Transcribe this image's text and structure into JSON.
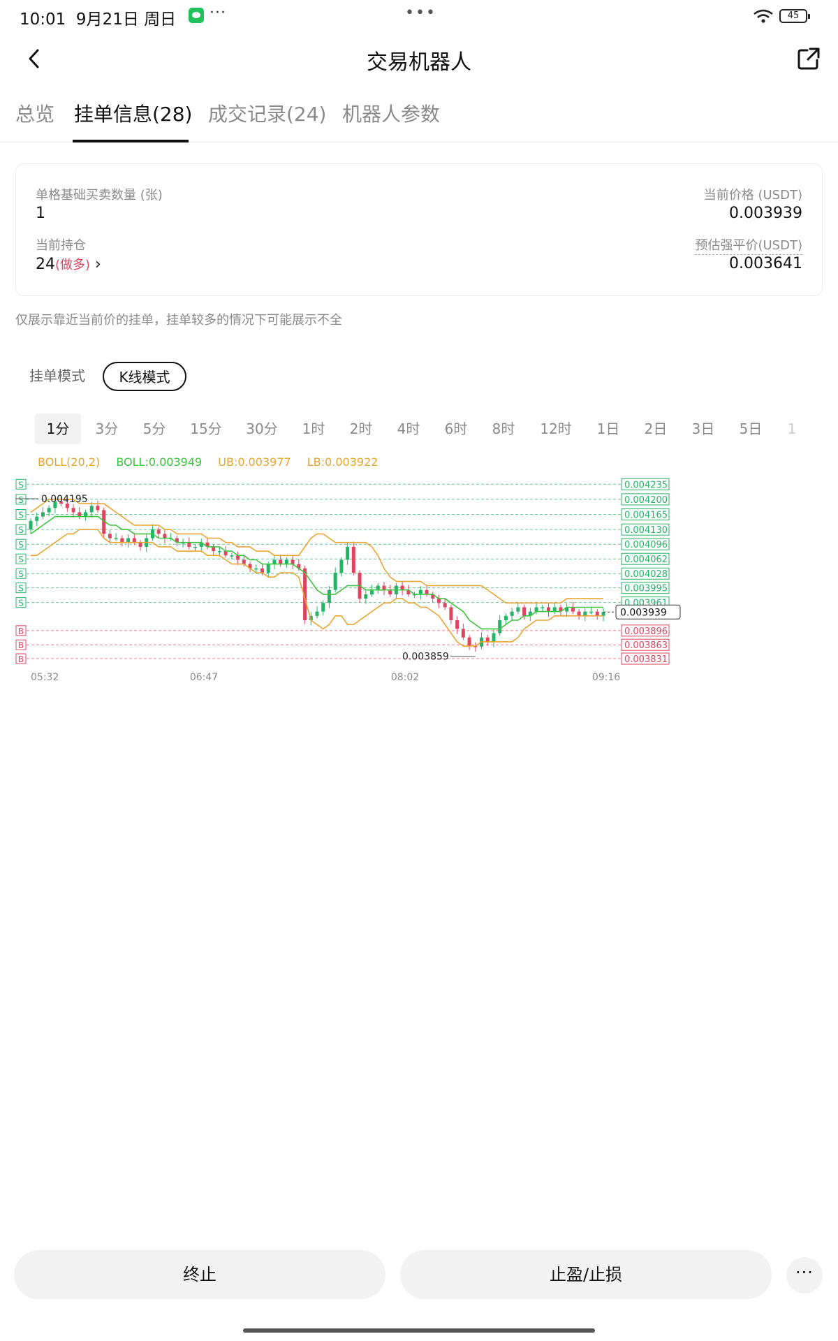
{
  "status_bar": {
    "time": "10:01",
    "date": "9月21日 周日",
    "more": "···",
    "center": "•••",
    "battery": "45",
    "wechat_icon": "wechat-icon",
    "wifi_icon": "wifi-icon"
  },
  "nav": {
    "title": "交易机器人",
    "back_icon": "chevron-left-icon",
    "share_icon": "share-external-icon"
  },
  "tabs": [
    {
      "label": "总览"
    },
    {
      "label": "挂单信息(28)"
    },
    {
      "label": "成交记录(24)"
    },
    {
      "label": "机器人参数"
    }
  ],
  "active_tab": 1,
  "summary": {
    "qty_label": "单格基础买卖数量 (张)",
    "qty_value": "1",
    "price_label": "当前价格 (USDT)",
    "price_value": "0.003939",
    "position_label": "当前持仓",
    "position_value": "24",
    "position_side": "(做多)",
    "position_arrow": "›",
    "liq_label": "预估强平价(USDT)",
    "liq_value": "0.003641"
  },
  "notice": "仅展示靠近当前价的挂单，挂单较多的情况下可能展示不全",
  "modes": {
    "order": "挂单模式",
    "kline": "K线模式"
  },
  "active_mode": "kline",
  "intervals": [
    "1分",
    "3分",
    "5分",
    "15分",
    "30分",
    "1时",
    "2时",
    "4时",
    "6时",
    "8时",
    "12时",
    "1日",
    "2日",
    "3日",
    "5日",
    "1"
  ],
  "active_interval": 0,
  "boll": {
    "name": "BOLL(20,2)",
    "mid": "BOLL:0.003949",
    "ub": "UB:0.003977",
    "lb": "LB:0.003922"
  },
  "colors": {
    "up": "#25b366",
    "down": "#e0455f",
    "boll_mid": "#3ec43e",
    "boll_band": "#e8a532",
    "grid_sell": "#25b366",
    "grid_buy": "#e0455f",
    "accent": "#111111"
  },
  "chart_data": {
    "type": "candlestick",
    "x_ticks": [
      "05:32",
      "06:47",
      "08:02",
      "09:16"
    ],
    "sell_levels": [
      "0.004235",
      "0.004200",
      "0.004165",
      "0.004130",
      "0.004096",
      "0.004062",
      "0.004028",
      "0.003995",
      "0.003961"
    ],
    "buy_levels": [
      "0.003896",
      "0.003863",
      "0.003831"
    ],
    "sell_marker": "S",
    "buy_marker": "B",
    "current_price": "0.003939",
    "high_annotation": "0.004195",
    "low_annotation": "0.003859",
    "ylim": [
      0.00381,
      0.00425
    ],
    "close": [
      0.00415,
      0.00416,
      0.00417,
      0.00418,
      0.004195,
      0.00419,
      0.00418,
      0.00417,
      0.00416,
      0.00417,
      0.004185,
      0.004175,
      0.00412,
      0.00411,
      0.00411,
      0.0041,
      0.00411,
      0.0041,
      0.00409,
      0.00411,
      0.00413,
      0.00412,
      0.00411,
      0.00411,
      0.0041,
      0.0041,
      0.00409,
      0.00409,
      0.0041,
      0.00409,
      0.00408,
      0.00408,
      0.00407,
      0.00407,
      0.00406,
      0.00405,
      0.00404,
      0.00404,
      0.00403,
      0.00405,
      0.00406,
      0.00405,
      0.00406,
      0.00405,
      0.00404,
      0.00392,
      0.00393,
      0.00394,
      0.00396,
      0.00399,
      0.00403,
      0.00406,
      0.00409,
      0.00403,
      0.00397,
      0.00398,
      0.00399,
      0.004,
      0.00399,
      0.00398,
      0.004,
      0.00399,
      0.00398,
      0.00398,
      0.00399,
      0.00398,
      0.00397,
      0.00396,
      0.00395,
      0.00392,
      0.0039,
      0.00388,
      0.00386,
      0.003859,
      0.00388,
      0.00387,
      0.00389,
      0.00392,
      0.00393,
      0.00394,
      0.00395,
      0.00393,
      0.00394,
      0.00395,
      0.00395,
      0.00394,
      0.00395,
      0.00394,
      0.00395,
      0.00394,
      0.00393,
      0.00394,
      0.00394,
      0.00393,
      0.003939
    ],
    "boll_mid": [
      0.00412,
      0.00413,
      0.00414,
      0.00415,
      0.00416,
      0.00416,
      0.00416,
      0.00416,
      0.00416,
      0.00416,
      0.00416,
      0.00416,
      0.00415,
      0.00414,
      0.00414,
      0.00413,
      0.00413,
      0.00412,
      0.00412,
      0.00412,
      0.00412,
      0.00411,
      0.00411,
      0.00411,
      0.0041,
      0.0041,
      0.0041,
      0.0041,
      0.0041,
      0.00409,
      0.00409,
      0.00409,
      0.00408,
      0.00408,
      0.00407,
      0.00407,
      0.00406,
      0.00406,
      0.00405,
      0.00405,
      0.00405,
      0.00405,
      0.00405,
      0.00405,
      0.00404,
      0.00403,
      0.00401,
      0.00399,
      0.00398,
      0.00398,
      0.00398,
      0.00399,
      0.004,
      0.004,
      0.004,
      0.00399,
      0.00399,
      0.00399,
      0.00399,
      0.00399,
      0.00399,
      0.00399,
      0.00399,
      0.00398,
      0.00398,
      0.00398,
      0.00398,
      0.00397,
      0.00397,
      0.00396,
      0.00395,
      0.00394,
      0.00392,
      0.00391,
      0.0039,
      0.0039,
      0.0039,
      0.0039,
      0.00391,
      0.00392,
      0.00392,
      0.00393,
      0.00393,
      0.00394,
      0.00394,
      0.00394,
      0.00394,
      0.00394,
      0.00395,
      0.00395,
      0.00395,
      0.00395,
      0.00395,
      0.00395,
      0.00395
    ],
    "boll_ub": [
      0.00417,
      0.00418,
      0.00419,
      0.0042,
      0.0042,
      0.0042,
      0.0042,
      0.0042,
      0.00419,
      0.00419,
      0.00419,
      0.00419,
      0.00419,
      0.00418,
      0.00417,
      0.00416,
      0.00415,
      0.00414,
      0.00414,
      0.00414,
      0.00414,
      0.00414,
      0.00413,
      0.00413,
      0.00412,
      0.00412,
      0.00412,
      0.00412,
      0.00412,
      0.00411,
      0.00411,
      0.00411,
      0.0041,
      0.0041,
      0.00409,
      0.00409,
      0.00409,
      0.00408,
      0.00408,
      0.00408,
      0.00407,
      0.00407,
      0.00407,
      0.00407,
      0.00407,
      0.00409,
      0.00411,
      0.00412,
      0.00412,
      0.00411,
      0.0041,
      0.0041,
      0.0041,
      0.0041,
      0.0041,
      0.0041,
      0.00409,
      0.00407,
      0.00404,
      0.00402,
      0.00401,
      0.00401,
      0.00401,
      0.00401,
      0.00401,
      0.004,
      0.004,
      0.004,
      0.004,
      0.004,
      0.004,
      0.004,
      0.004,
      0.004,
      0.004,
      0.00399,
      0.00398,
      0.00397,
      0.00396,
      0.00396,
      0.00396,
      0.00396,
      0.00396,
      0.00396,
      0.00396,
      0.00396,
      0.00396,
      0.00396,
      0.00397,
      0.00397,
      0.00397,
      0.00397,
      0.00397,
      0.00397,
      0.00397
    ],
    "boll_lb": [
      0.00407,
      0.00407,
      0.00408,
      0.00409,
      0.0041,
      0.00411,
      0.00412,
      0.00412,
      0.00413,
      0.00413,
      0.00413,
      0.00413,
      0.00411,
      0.0041,
      0.0041,
      0.0041,
      0.0041,
      0.0041,
      0.0041,
      0.0041,
      0.0041,
      0.00409,
      0.00409,
      0.00409,
      0.00408,
      0.00408,
      0.00408,
      0.00408,
      0.00408,
      0.00407,
      0.00407,
      0.00407,
      0.00406,
      0.00405,
      0.00405,
      0.00405,
      0.00404,
      0.00403,
      0.00403,
      0.00402,
      0.00402,
      0.00403,
      0.00403,
      0.00403,
      0.00402,
      0.00397,
      0.00392,
      0.00391,
      0.0039,
      0.00391,
      0.00393,
      0.00393,
      0.00391,
      0.00391,
      0.00392,
      0.00393,
      0.00394,
      0.00395,
      0.00396,
      0.00396,
      0.00397,
      0.00397,
      0.00396,
      0.00396,
      0.00395,
      0.00395,
      0.00394,
      0.00393,
      0.00391,
      0.00389,
      0.00387,
      0.00386,
      0.00386,
      0.00386,
      0.00387,
      0.00387,
      0.00387,
      0.00387,
      0.00387,
      0.00387,
      0.00388,
      0.0039,
      0.00391,
      0.00392,
      0.00392,
      0.00392,
      0.00393,
      0.00393,
      0.00393,
      0.00393,
      0.00393,
      0.00393,
      0.00393,
      0.00393,
      0.00393
    ]
  },
  "bottom": {
    "stop": "终止",
    "tpsl": "止盈/止损",
    "more": "···"
  }
}
